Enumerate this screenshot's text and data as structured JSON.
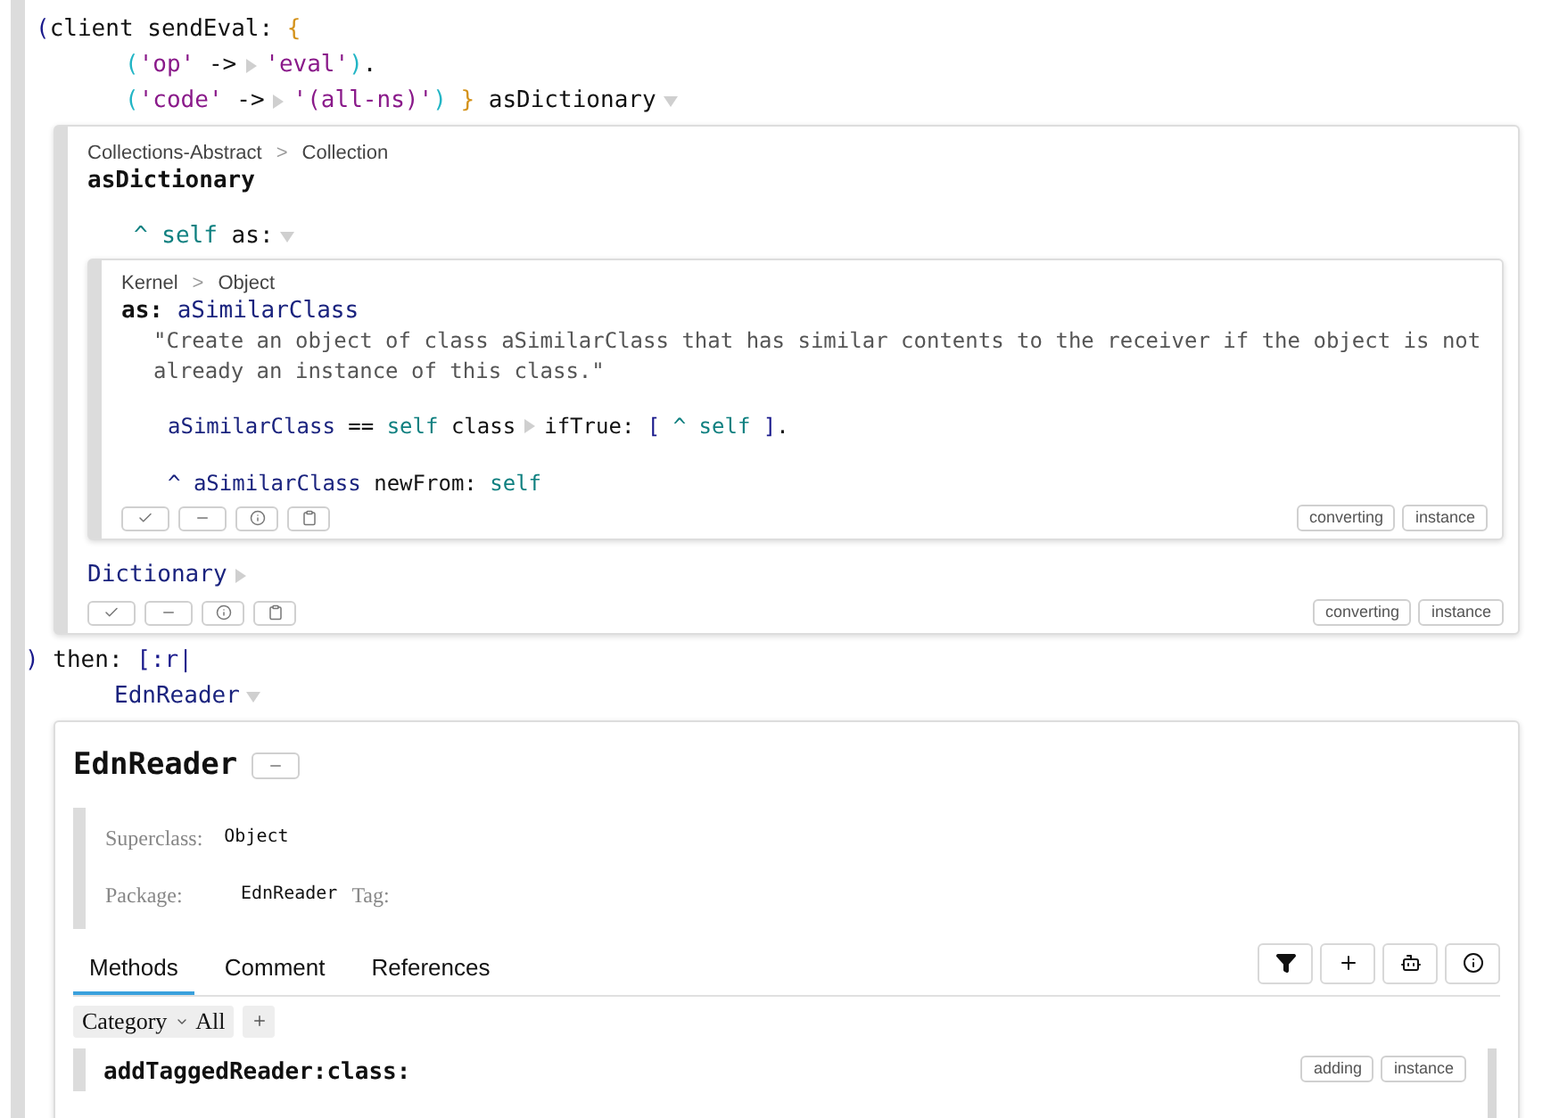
{
  "top_code": [
    {
      "tokens": [
        {
          "kind": "bracket",
          "t": "("
        },
        {
          "kind": "plain",
          "t": "client sendEval: "
        },
        {
          "kind": "brace",
          "t": "{"
        }
      ],
      "children": [
        {
          "tokens": [
            {
              "kind": "paren",
              "t": "("
            },
            {
              "kind": "string",
              "t": "'op'"
            },
            {
              "kind": "plain",
              "t": " ->"
            },
            {
              "kind": "expander",
              "expanded": false
            },
            {
              "kind": "string",
              "t": "'eval'"
            },
            {
              "kind": "paren",
              "t": ")"
            },
            {
              "kind": "plain",
              "t": "."
            }
          ]
        },
        {
          "tokens": [
            {
              "kind": "paren",
              "t": "("
            },
            {
              "kind": "string",
              "t": "'code'"
            },
            {
              "kind": "plain",
              "t": " ->"
            },
            {
              "kind": "expander",
              "expanded": false
            },
            {
              "kind": "string",
              "t": "'(all-ns)'"
            },
            {
              "kind": "paren",
              "t": ")"
            },
            {
              "kind": "brace",
              "t": " }"
            },
            {
              "kind": "plain",
              "t": " asDictionary"
            },
            {
              "kind": "expander",
              "expanded": true
            }
          ]
        }
      ]
    }
  ],
  "method_panel": {
    "breadcrumb": [
      "Collections-Abstract",
      "Collection"
    ],
    "separator": ">",
    "title": "asDictionary",
    "code": [
      {
        "tokens": [
          {
            "kind": "self",
            "t": "^ self"
          },
          {
            "kind": "plain",
            "t": " as:"
          },
          {
            "kind": "expander",
            "expanded": true
          }
        ]
      }
    ],
    "inner_panel": {
      "breadcrumb": [
        "Kernel",
        "Object"
      ],
      "separator": ">",
      "keyword": "as:",
      "argument": "aSimilarClass",
      "comment": "\"Create an object of class aSimilarClass that has similar contents to the receiver if the object is not already an instance of this class.\"",
      "code": [
        {
          "tokens": [
            {
              "kind": "var",
              "t": "aSimilarClass"
            },
            {
              "kind": "plain",
              "t": " == "
            },
            {
              "kind": "self",
              "t": "self"
            },
            {
              "kind": "plain",
              "t": " class"
            },
            {
              "kind": "expander",
              "expanded": false
            },
            {
              "kind": "plain",
              "t": "ifTrue: "
            },
            {
              "kind": "bracket",
              "t": "["
            },
            {
              "kind": "self",
              "t": " ^ self "
            },
            {
              "kind": "bracket",
              "t": "]"
            },
            {
              "kind": "plain",
              "t": "."
            }
          ]
        },
        {
          "tokens": [
            {
              "kind": "var",
              "t": "^ aSimilarClass"
            },
            {
              "kind": "plain",
              "t": " newFrom: "
            },
            {
              "kind": "self",
              "t": "self"
            }
          ]
        }
      ],
      "actions": [
        {
          "kind": "accept"
        },
        {
          "kind": "remove"
        },
        {
          "kind": "inspect"
        },
        {
          "kind": "copy"
        }
      ],
      "tags": [
        "converting",
        "instance"
      ]
    },
    "result_code": [
      {
        "tokens": [
          {
            "kind": "var",
            "t": "Dictionary"
          },
          {
            "kind": "expander",
            "expanded": false
          }
        ]
      }
    ],
    "actions": [
      {
        "kind": "accept"
      },
      {
        "kind": "remove"
      },
      {
        "kind": "inspect"
      },
      {
        "kind": "copy"
      }
    ],
    "tags": [
      "converting",
      "instance"
    ]
  },
  "middle_code": [
    {
      "tokens": [
        {
          "kind": "bracket",
          "t": ")"
        },
        {
          "kind": "plain",
          "t": " then: "
        },
        {
          "kind": "bracket",
          "t": "[:r|"
        }
      ],
      "children": [
        {
          "tokens": [
            {
              "kind": "var",
              "t": "EdnReader"
            },
            {
              "kind": "expander",
              "expanded": true
            }
          ]
        }
      ]
    }
  ],
  "class_panel": {
    "title": "EdnReader",
    "superclass": {
      "label": "Superclass:",
      "value": "Object"
    },
    "package": {
      "label": "Package:",
      "value": "EdnReader"
    },
    "tag": {
      "label": "Tag:"
    },
    "tabs": [
      {
        "label": "Methods",
        "selected": true
      },
      {
        "label": "Comment",
        "selected": false
      },
      {
        "label": "References",
        "selected": false
      }
    ],
    "tools": [
      {
        "kind": "filter"
      },
      {
        "kind": "add"
      },
      {
        "kind": "robot"
      },
      {
        "kind": "info"
      }
    ],
    "category": "Category",
    "all": "All",
    "methods": [
      {
        "name": "addTaggedReader:class:",
        "tags": [
          "adding",
          "instance"
        ]
      }
    ]
  }
}
